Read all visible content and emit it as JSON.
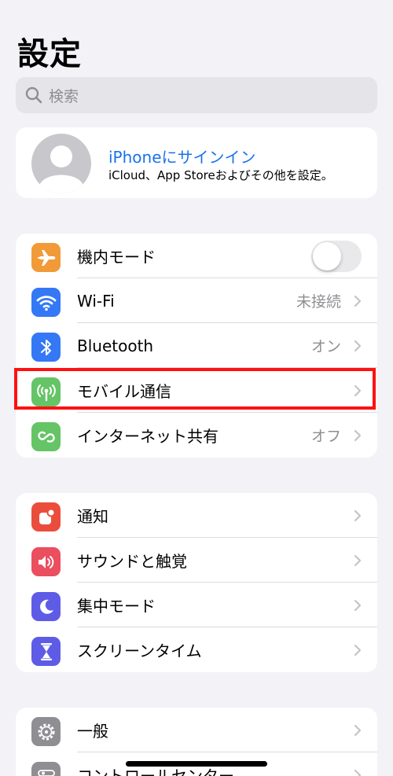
{
  "header": {
    "title": "設定"
  },
  "search": {
    "placeholder": "検索"
  },
  "profile": {
    "title": "iPhoneにサインイン",
    "subtitle": "iCloud、App Storeおよびその他を設定。"
  },
  "connectivity": {
    "items": [
      {
        "label": "機内モード",
        "icon": "airplane-icon",
        "color": "#f19a37",
        "toggle": false
      },
      {
        "label": "Wi-Fi",
        "value": "未接続",
        "icon": "wifi-icon",
        "color": "#3478f6"
      },
      {
        "label": "Bluetooth",
        "value": "オン",
        "icon": "bluetooth-icon",
        "color": "#3478f6"
      },
      {
        "label": "モバイル通信",
        "value": "",
        "icon": "antenna-icon",
        "color": "#65c466",
        "highlighted": true
      },
      {
        "label": "インターネット共有",
        "value": "オフ",
        "icon": "hotspot-icon",
        "color": "#65c466"
      }
    ]
  },
  "notifications": {
    "items": [
      {
        "label": "通知",
        "icon": "notification-icon",
        "color": "#eb4d3d"
      },
      {
        "label": "サウンドと触覚",
        "icon": "speaker-icon",
        "color": "#eb4e5e"
      },
      {
        "label": "集中モード",
        "icon": "moon-icon",
        "color": "#5e5ce6"
      },
      {
        "label": "スクリーンタイム",
        "icon": "hourglass-icon",
        "color": "#5e5ce6"
      }
    ]
  },
  "general": {
    "items": [
      {
        "label": "一般",
        "icon": "gear-icon",
        "color": "#8e8e93"
      },
      {
        "label": "コントロールセンター",
        "icon": "control-center-icon",
        "color": "#8e8e93"
      }
    ]
  }
}
